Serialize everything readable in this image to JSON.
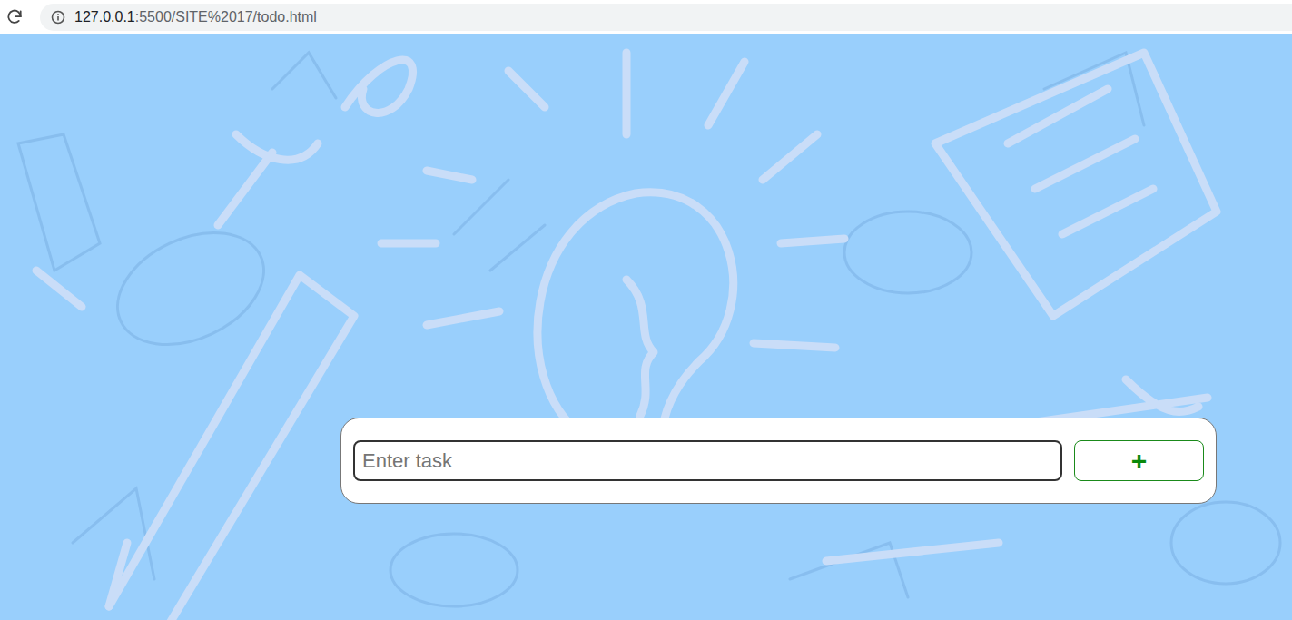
{
  "browser": {
    "address_bar": {
      "host": "127.0.0.1",
      "path": ":5500/SITE%2017/todo.html"
    }
  },
  "todo_form": {
    "input": {
      "placeholder": "Enter task",
      "value": ""
    },
    "add_button": {
      "label": "+"
    }
  }
}
